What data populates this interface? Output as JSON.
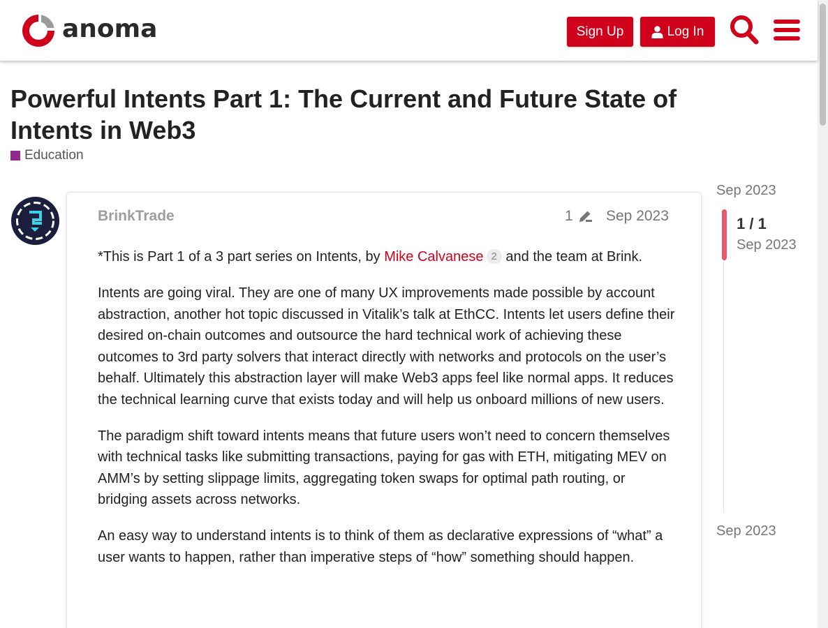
{
  "header": {
    "logo_text": "anoma",
    "signup_label": "Sign Up",
    "login_label": "Log In",
    "brand_color": "#d0021b",
    "icons": [
      "search-icon",
      "hamburger-menu-icon",
      "user-icon"
    ]
  },
  "topic": {
    "title": "Powerful Intents Part 1: The Current and Future State of Intents in Web3",
    "category": "Education",
    "category_color": "#92278f"
  },
  "post": {
    "username": "BrinkTrade",
    "edit_count": "1",
    "date": "Sep 2023",
    "p1_before": "*This is Part 1 of a 3 part series on Intents, by ",
    "mention_name": "Mike Calvanese",
    "mention_count": "2",
    "p1_after": " and the team at Brink.",
    "p2": "Intents are going viral. They are one of many UX improvements made possible by account abstraction, another hot topic discussed in Vitalik’s talk at EthCC. Intents let users define their desired on-chain outcomes and outsource the hard technical work of achieving these outcomes to 3rd party solvers that interact directly with networks and protocols on the user’s behalf. Ultimately this abstraction layer will make Web3 apps feel like normal apps. It reduces the technical learning curve that exists today and will help us onboard millions of new users.",
    "p3": "The paradigm shift toward intents means that future users won’t need to concern themselves with technical tasks like submitting transactions, paying for gas with ETH, mitigating MEV on AMM’s by setting slippage limits, aggregating token swaps for optimal path routing, or bridging assets across networks.",
    "p4": "An easy way to understand intents is to think of them as declarative expressions of “what” a user wants to happen, rather than imperative steps of “how” something should happen."
  },
  "timeline": {
    "top_date": "Sep 2023",
    "position": "1 / 1",
    "position_date": "Sep 2023",
    "bottom_date": "Sep 2023",
    "accent_color": "#e45a6c"
  }
}
